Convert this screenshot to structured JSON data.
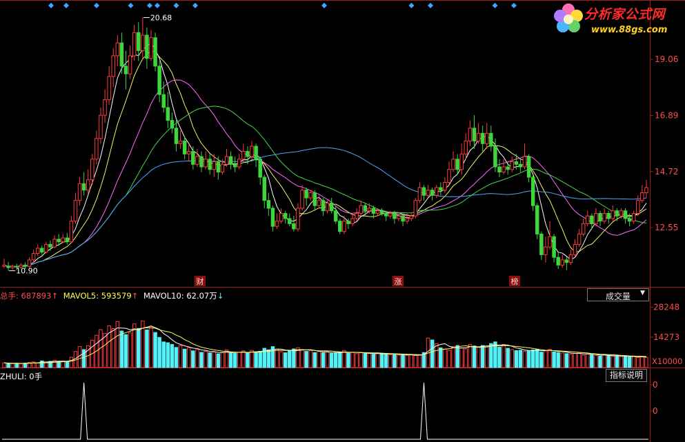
{
  "chart_data": [
    {
      "type": "candlestick",
      "panel": "price",
      "ylim": [
        10.55,
        21.2
      ],
      "y_ticks": [
        "19.06",
        "16.89",
        "14.72",
        "12.55"
      ],
      "annotations": {
        "high_label": "20.68",
        "low_label": "10.90"
      },
      "event_markers": [
        "财",
        "涨",
        "榜"
      ],
      "moving_average_colors": [
        "#ffffff",
        "#f4f46a",
        "#ff6cff",
        "#48d848",
        "#4ea8ff"
      ],
      "bar_colors": {
        "up": "#ff3c3c",
        "down": "#3dd63d",
        "flat": "#ffffff"
      },
      "candles": [
        [
          11.05,
          11.1,
          10.98,
          11.35
        ],
        [
          11.06,
          11.0,
          10.88,
          11.22
        ],
        [
          11.0,
          11.05,
          10.92,
          11.12
        ],
        [
          11.05,
          11.02,
          10.9,
          11.15
        ],
        [
          11.02,
          11.1,
          10.95,
          11.18
        ],
        [
          11.1,
          11.05,
          10.95,
          11.2
        ],
        [
          11.05,
          11.3,
          11.0,
          11.4
        ],
        [
          11.3,
          11.55,
          11.2,
          11.7
        ],
        [
          11.55,
          11.75,
          11.45,
          11.9
        ],
        [
          11.75,
          11.6,
          11.5,
          11.85
        ],
        [
          11.6,
          11.9,
          11.55,
          12.0
        ],
        [
          11.9,
          11.8,
          11.65,
          12.05
        ],
        [
          11.8,
          12.1,
          11.75,
          12.25
        ],
        [
          12.1,
          12.0,
          11.85,
          12.3
        ],
        [
          12.0,
          12.15,
          11.95,
          12.3
        ],
        [
          12.15,
          12.0,
          11.9,
          12.35
        ],
        [
          12.0,
          12.8,
          11.95,
          13.0
        ],
        [
          12.8,
          13.6,
          12.7,
          13.9
        ],
        [
          13.6,
          14.25,
          13.4,
          14.5
        ],
        [
          14.25,
          14.0,
          13.8,
          14.7
        ],
        [
          14.0,
          14.4,
          13.85,
          14.8
        ],
        [
          14.4,
          15.2,
          14.2,
          15.4
        ],
        [
          15.2,
          16.0,
          15.0,
          16.3
        ],
        [
          16.0,
          16.9,
          15.8,
          17.2
        ],
        [
          16.9,
          17.5,
          16.6,
          17.9
        ],
        [
          17.5,
          18.4,
          17.3,
          18.8
        ],
        [
          18.4,
          19.2,
          18.0,
          19.5
        ],
        [
          19.2,
          19.7,
          18.8,
          20.0
        ],
        [
          19.7,
          18.8,
          18.5,
          20.1
        ],
        [
          18.8,
          18.5,
          17.9,
          19.4
        ],
        [
          18.5,
          19.2,
          18.3,
          19.6
        ],
        [
          19.2,
          20.1,
          19.0,
          20.4
        ],
        [
          20.1,
          19.4,
          19.0,
          20.5
        ],
        [
          19.4,
          20.0,
          19.1,
          20.68
        ],
        [
          20.0,
          19.1,
          18.7,
          20.3
        ],
        [
          19.1,
          19.9,
          19.0,
          20.2
        ],
        [
          19.9,
          18.8,
          18.6,
          20.1
        ],
        [
          18.8,
          17.7,
          17.4,
          19.0
        ],
        [
          17.7,
          17.2,
          17.0,
          18.2
        ],
        [
          17.2,
          16.7,
          16.4,
          17.8
        ],
        [
          16.7,
          16.4,
          16.2,
          17.0
        ],
        [
          16.4,
          15.8,
          15.5,
          16.7
        ],
        [
          15.8,
          15.9,
          15.6,
          16.3
        ],
        [
          15.9,
          15.4,
          15.2,
          16.1
        ],
        [
          15.4,
          15.5,
          15.1,
          15.8
        ],
        [
          15.5,
          15.0,
          14.8,
          15.7
        ],
        [
          15.0,
          15.3,
          14.9,
          15.6
        ],
        [
          15.3,
          14.9,
          14.7,
          15.5
        ],
        [
          14.9,
          15.2,
          14.8,
          15.5
        ],
        [
          15.2,
          14.8,
          14.6,
          15.4
        ],
        [
          14.8,
          15.1,
          14.5,
          15.4
        ],
        [
          15.1,
          14.7,
          14.4,
          15.3
        ],
        [
          14.7,
          15.0,
          14.6,
          15.2
        ],
        [
          15.0,
          15.3,
          14.9,
          15.6
        ],
        [
          15.3,
          15.0,
          14.8,
          15.5
        ],
        [
          15.0,
          14.9,
          14.7,
          15.3
        ],
        [
          14.9,
          15.2,
          14.8,
          15.4
        ],
        [
          15.2,
          15.5,
          15.1,
          15.8
        ],
        [
          15.5,
          15.3,
          15.0,
          15.7
        ],
        [
          15.3,
          15.7,
          15.2,
          15.9
        ],
        [
          15.7,
          15.2,
          14.9,
          15.8
        ],
        [
          15.2,
          14.5,
          14.2,
          15.3
        ],
        [
          14.5,
          13.6,
          13.3,
          14.6
        ],
        [
          13.6,
          13.3,
          13.0,
          13.9
        ],
        [
          13.3,
          12.6,
          12.4,
          13.4
        ],
        [
          12.6,
          12.8,
          12.5,
          13.1
        ],
        [
          12.8,
          13.1,
          12.7,
          13.3
        ],
        [
          13.1,
          12.9,
          12.7,
          13.2
        ],
        [
          12.9,
          12.7,
          12.6,
          13.1
        ],
        [
          12.7,
          12.5,
          12.4,
          13.0
        ],
        [
          12.5,
          13.3,
          12.4,
          13.5
        ],
        [
          13.3,
          14.0,
          13.2,
          14.2
        ],
        [
          14.0,
          13.7,
          13.4,
          14.1
        ],
        [
          13.7,
          13.9,
          13.6,
          14.0
        ],
        [
          13.9,
          13.4,
          13.2,
          14.0
        ],
        [
          13.4,
          13.6,
          13.3,
          13.8
        ],
        [
          13.6,
          13.2,
          13.0,
          13.7
        ],
        [
          13.2,
          13.5,
          13.1,
          13.6
        ],
        [
          13.5,
          13.2,
          13.1,
          13.7
        ],
        [
          13.2,
          12.8,
          12.7,
          13.4
        ],
        [
          12.8,
          12.4,
          12.3,
          12.9
        ],
        [
          12.4,
          12.8,
          12.3,
          13.0
        ],
        [
          12.8,
          12.7,
          12.5,
          12.9
        ],
        [
          12.7,
          12.9,
          12.6,
          13.1
        ],
        [
          12.9,
          13.1,
          12.8,
          13.3
        ],
        [
          13.1,
          13.4,
          13.0,
          13.6
        ],
        [
          13.4,
          13.2,
          13.0,
          13.5
        ],
        [
          13.2,
          13.3,
          13.1,
          13.5
        ],
        [
          13.3,
          13.1,
          12.9,
          13.4
        ],
        [
          13.1,
          13.2,
          13.0,
          13.3
        ],
        [
          13.2,
          13.1,
          13.0,
          13.3
        ],
        [
          13.1,
          13.0,
          12.8,
          13.2
        ],
        [
          13.0,
          13.1,
          12.9,
          13.2
        ],
        [
          13.1,
          12.9,
          12.7,
          13.2
        ],
        [
          12.9,
          13.0,
          12.8,
          13.1
        ],
        [
          13.0,
          12.8,
          12.6,
          13.1
        ],
        [
          12.8,
          12.9,
          12.7,
          13.1
        ],
        [
          12.9,
          13.0,
          12.8,
          13.1
        ],
        [
          13.0,
          13.6,
          12.9,
          13.7
        ],
        [
          13.6,
          14.1,
          13.5,
          14.3
        ],
        [
          14.1,
          13.8,
          13.6,
          14.2
        ],
        [
          13.8,
          14.0,
          13.7,
          14.2
        ],
        [
          14.0,
          13.8,
          13.6,
          14.1
        ],
        [
          13.8,
          14.1,
          13.7,
          14.2
        ],
        [
          14.1,
          14.0,
          13.8,
          14.3
        ],
        [
          14.0,
          14.3,
          13.9,
          14.5
        ],
        [
          14.3,
          14.8,
          14.2,
          15.1
        ],
        [
          14.8,
          15.2,
          14.7,
          15.5
        ],
        [
          15.2,
          14.8,
          14.6,
          15.4
        ],
        [
          14.8,
          15.4,
          14.6,
          15.8
        ],
        [
          15.4,
          15.9,
          15.2,
          16.2
        ],
        [
          15.9,
          16.4,
          15.7,
          16.7
        ],
        [
          16.4,
          15.9,
          15.6,
          16.9
        ],
        [
          15.9,
          16.2,
          15.8,
          16.6
        ],
        [
          16.2,
          15.8,
          15.5,
          16.5
        ],
        [
          15.8,
          16.2,
          15.6,
          16.6
        ],
        [
          16.2,
          15.7,
          15.5,
          16.5
        ],
        [
          15.7,
          14.9,
          14.7,
          16.0
        ],
        [
          14.9,
          14.7,
          14.5,
          15.2
        ],
        [
          14.7,
          14.9,
          14.6,
          15.2
        ],
        [
          14.9,
          14.8,
          14.6,
          15.1
        ],
        [
          14.8,
          15.1,
          14.7,
          15.3
        ],
        [
          15.1,
          15.0,
          14.8,
          15.4
        ],
        [
          15.0,
          14.9,
          14.7,
          15.2
        ],
        [
          14.9,
          15.3,
          14.8,
          15.8
        ],
        [
          15.3,
          14.5,
          14.3,
          15.4
        ],
        [
          14.5,
          13.4,
          13.2,
          14.6
        ],
        [
          13.4,
          12.3,
          12.1,
          13.5
        ],
        [
          12.3,
          11.5,
          11.3,
          12.4
        ],
        [
          11.5,
          11.8,
          11.2,
          12.2
        ],
        [
          11.8,
          12.2,
          11.7,
          12.8
        ],
        [
          12.2,
          11.4,
          11.2,
          12.3
        ],
        [
          11.4,
          11.1,
          10.95,
          11.6
        ],
        [
          11.1,
          11.3,
          11.0,
          11.5
        ],
        [
          11.3,
          11.2,
          10.9,
          11.4
        ],
        [
          11.2,
          11.5,
          11.1,
          11.7
        ],
        [
          11.5,
          11.9,
          11.4,
          12.1
        ],
        [
          11.9,
          12.3,
          11.8,
          12.5
        ],
        [
          12.3,
          12.7,
          12.2,
          12.9
        ],
        [
          12.7,
          13.0,
          12.6,
          13.2
        ],
        [
          13.0,
          12.7,
          12.5,
          13.1
        ],
        [
          12.7,
          13.1,
          12.6,
          13.3
        ],
        [
          13.1,
          12.8,
          12.6,
          13.2
        ],
        [
          12.8,
          13.1,
          12.7,
          13.3
        ],
        [
          13.1,
          12.9,
          12.7,
          13.2
        ],
        [
          12.9,
          13.2,
          12.8,
          13.4
        ],
        [
          13.2,
          13.0,
          12.8,
          13.3
        ],
        [
          13.0,
          13.2,
          12.9,
          13.3
        ],
        [
          13.2,
          12.9,
          12.7,
          13.3
        ],
        [
          12.9,
          12.8,
          12.6,
          13.1
        ],
        [
          12.8,
          13.1,
          12.7,
          13.2
        ],
        [
          13.1,
          13.6,
          13.0,
          13.8
        ],
        [
          13.6,
          13.9,
          13.5,
          14.2
        ],
        [
          13.9,
          14.1,
          13.7,
          14.4
        ]
      ]
    },
    {
      "type": "bar",
      "panel": "volume",
      "title": "成交量",
      "unit_label": "X10000",
      "ylim": [
        0,
        30000
      ],
      "y_ticks": [
        "28248",
        "14273"
      ],
      "header": {
        "total_label": "总手:",
        "total_value": "687893",
        "ma5_label": "MAVOL5:",
        "ma5_value": "593579",
        "ma10_label": "MAVOL10:",
        "ma10_value": "62.07万"
      },
      "volume_line_colors": [
        "#ffffff",
        "#ffff55"
      ],
      "bar_colors": {
        "up": "#ff3c3c",
        "down": "#52f0f7"
      },
      "values": [
        2200,
        1900,
        1800,
        2000,
        1700,
        2100,
        2400,
        2600,
        2200,
        3100,
        2600,
        2900,
        3400,
        2800,
        3000,
        2600,
        4800,
        7500,
        9800,
        8400,
        10200,
        12800,
        15100,
        17700,
        15900,
        19500,
        18200,
        21500,
        17100,
        15400,
        16200,
        20400,
        18300,
        21800,
        17600,
        19200,
        16400,
        14100,
        12000,
        11600,
        10800,
        9400,
        10200,
        8600,
        9300,
        7800,
        8400,
        7100,
        7600,
        6900,
        7300,
        6400,
        7000,
        8200,
        6800,
        6600,
        7100,
        7800,
        6900,
        8000,
        7200,
        7600,
        9000,
        8300,
        9800,
        8600,
        7400,
        6900,
        7800,
        8700,
        9300,
        8200,
        7600,
        8000,
        7000,
        7500,
        6900,
        7300,
        6600,
        6800,
        7200,
        8000,
        6700,
        7100,
        6500,
        7000,
        6400,
        6600,
        6200,
        6700,
        6300,
        6500,
        6000,
        6200,
        5800,
        6100,
        5700,
        5900,
        5600,
        5800,
        7000,
        13800,
        12900,
        11200,
        9200,
        8700,
        8000,
        9800,
        10300,
        9100,
        8700,
        10800,
        10100,
        9700,
        10300,
        9600,
        11200,
        12000,
        9500,
        10800,
        9000,
        8400,
        7900,
        8100,
        7600,
        7800,
        8200,
        8600,
        7200,
        7800,
        8500,
        7300,
        7000,
        6800,
        6500,
        6200,
        6600,
        7000,
        5800,
        6300,
        6000,
        5700,
        5400,
        5900,
        5600,
        5200,
        5500,
        5100,
        5300,
        4900,
        5100,
        4700,
        5000,
        4800,
        4600,
        4400,
        4700,
        5200,
        5600,
        4200
      ]
    },
    {
      "type": "line",
      "panel": "indicator",
      "title": "ZHULI",
      "header": {
        "label": "ZHULI:",
        "value": "0手"
      },
      "help_button": "指标说明",
      "y_ticks": [
        "0",
        "0"
      ],
      "spikes_at_bar_index": [
        19,
        100
      ]
    }
  ],
  "logo": {
    "brand": "分析家公式网",
    "url": "www.88gs.com"
  }
}
